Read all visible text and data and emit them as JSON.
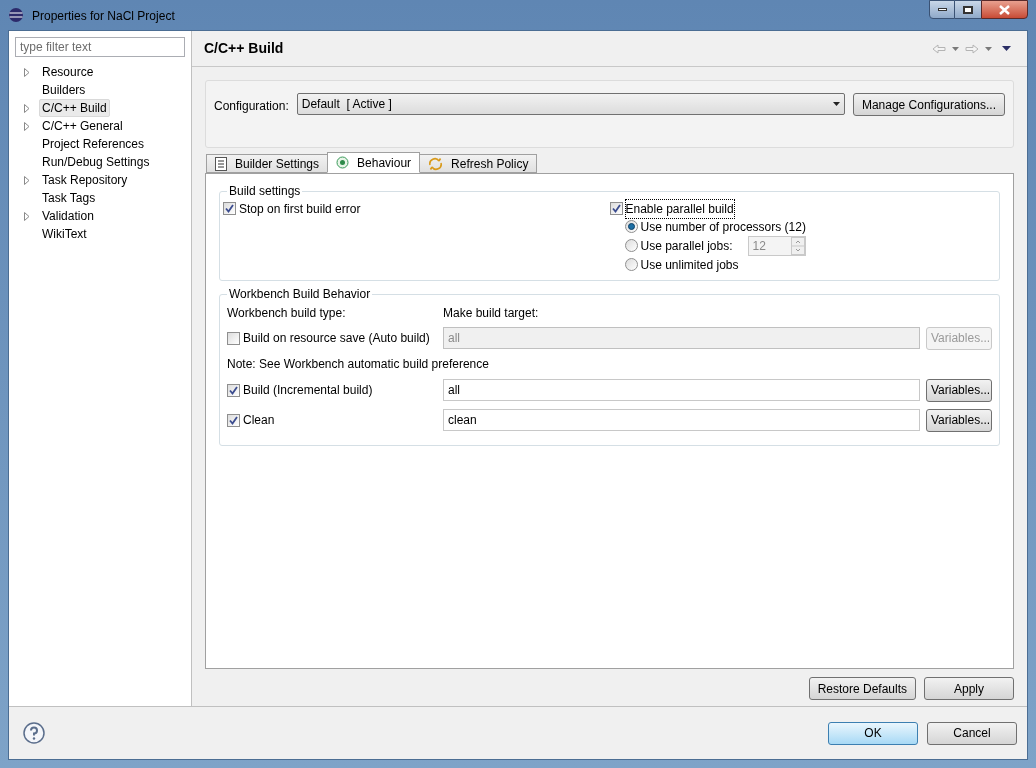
{
  "window": {
    "title": "Properties for NaCl Project"
  },
  "filter": {
    "placeholder": "type filter text"
  },
  "tree": [
    {
      "label": "Resource",
      "expandable": true,
      "selected": false
    },
    {
      "label": "Builders",
      "expandable": false,
      "selected": false
    },
    {
      "label": "C/C++ Build",
      "expandable": true,
      "selected": true
    },
    {
      "label": "C/C++ General",
      "expandable": true,
      "selected": false
    },
    {
      "label": "Project References",
      "expandable": false,
      "selected": false
    },
    {
      "label": "Run/Debug Settings",
      "expandable": false,
      "selected": false
    },
    {
      "label": "Task Repository",
      "expandable": true,
      "selected": false
    },
    {
      "label": "Task Tags",
      "expandable": false,
      "selected": false
    },
    {
      "label": "Validation",
      "expandable": true,
      "selected": false
    },
    {
      "label": "WikiText",
      "expandable": false,
      "selected": false
    }
  ],
  "page": {
    "title": "C/C++ Build"
  },
  "configuration": {
    "label": "Configuration:",
    "value": "Default  [ Active ]",
    "button": "Manage Configurations..."
  },
  "tabs": [
    {
      "label": "Builder Settings",
      "selected": false
    },
    {
      "label": "Behaviour",
      "selected": true
    },
    {
      "label": "Refresh Policy",
      "selected": false
    }
  ],
  "build_settings": {
    "title": "Build settings",
    "stop_on_error": {
      "label": "Stop on first build error",
      "checked": true
    },
    "parallel": {
      "label": "Enable parallel build",
      "checked": true,
      "options": [
        {
          "kind": "plain",
          "label": "Use number of processors (12)",
          "selected": true
        },
        {
          "kind": "spin",
          "label": "Use parallel jobs:",
          "value": "12",
          "selected": false
        },
        {
          "kind": "plain",
          "label": "Use unlimited jobs",
          "selected": false
        }
      ]
    }
  },
  "workbench": {
    "title": "Workbench Build Behavior",
    "type_heading": "Workbench build type:",
    "target_heading": "Make build target:",
    "rows": [
      {
        "kind": "option",
        "label": "Build on resource save (Auto build)",
        "checked": false,
        "target": "all",
        "disabled": true,
        "button": "Variables..."
      },
      {
        "kind": "note",
        "label": "Note: See Workbench automatic build preference"
      },
      {
        "kind": "option",
        "label": "Build (Incremental build)",
        "checked": true,
        "target": "all",
        "disabled": false,
        "button": "Variables..."
      },
      {
        "kind": "option",
        "label": "Clean",
        "checked": true,
        "target": "clean",
        "disabled": false,
        "button": "Variables..."
      }
    ]
  },
  "page_buttons": [
    "Restore Defaults",
    "Apply"
  ],
  "dialog_buttons": [
    {
      "label": "OK",
      "default": true
    },
    {
      "label": "Cancel",
      "default": false
    }
  ]
}
